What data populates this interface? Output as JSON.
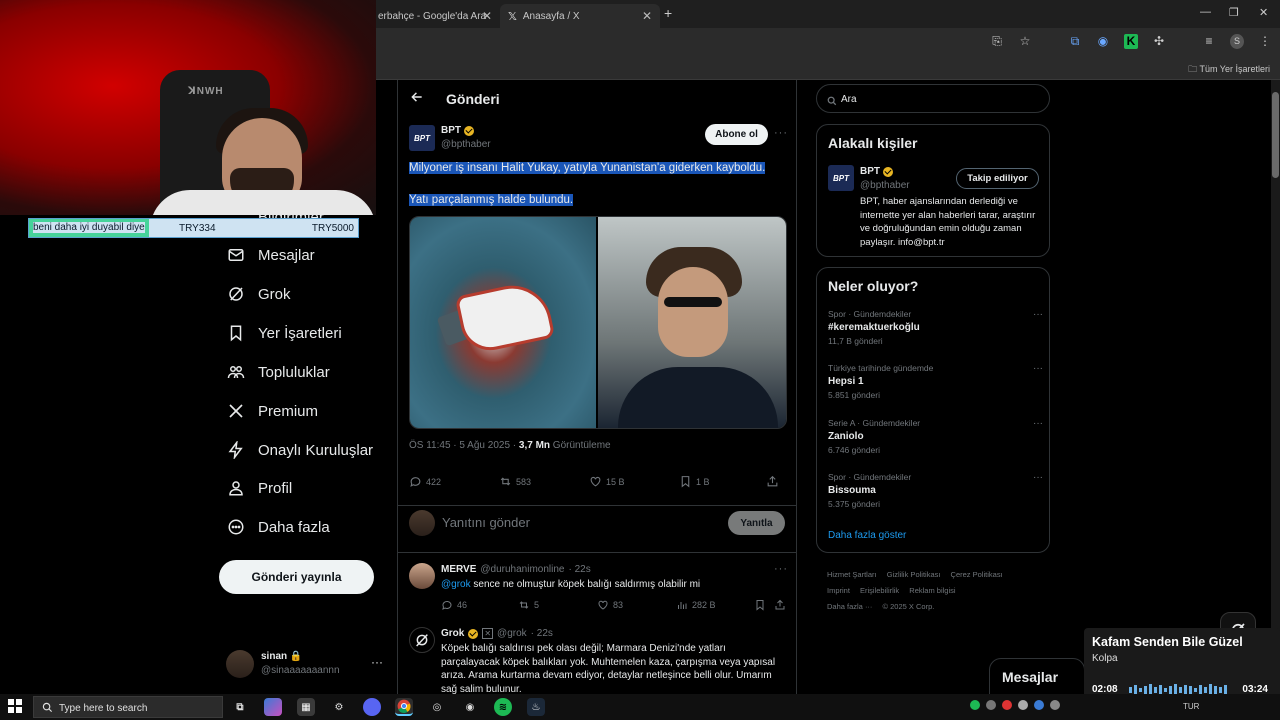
{
  "browser": {
    "tabs": [
      {
        "label": "erbahçe - Google'da Ara"
      },
      {
        "label": "Anasayfa / X"
      }
    ],
    "bookmarks_all": "Tüm Yer İşaretleri"
  },
  "donation": {
    "message": "beni daha iyi duyabil diye",
    "amount_mid": "TRY334",
    "amount_end": "TRY5000"
  },
  "nav": {
    "partial_item": "Bildirimler",
    "items": [
      {
        "label": "Mesajlar",
        "icon": "mail-icon"
      },
      {
        "label": "Grok",
        "icon": "grok-icon"
      },
      {
        "label": "Yer İşaretleri",
        "icon": "bookmark-icon"
      },
      {
        "label": "Topluluklar",
        "icon": "communities-icon"
      },
      {
        "label": "Premium",
        "icon": "x-logo-icon"
      },
      {
        "label": "Onaylı Kuruluşlar",
        "icon": "lightning-icon"
      },
      {
        "label": "Profil",
        "icon": "profile-icon"
      },
      {
        "label": "Daha fazla",
        "icon": "more-circle-icon"
      }
    ],
    "post_button": "Gönderi yayınla",
    "me": {
      "name": "sinan",
      "handle": "@sinaaaaaaannn"
    }
  },
  "post": {
    "header_title": "Gönderi",
    "author": {
      "name": "BPT",
      "handle": "@bpthaber",
      "logo_text": "BPT"
    },
    "subscribe_button": "Abone ol",
    "text_line1": "Milyoner iş insanı Halit Yukay, yatıyla Yunanistan'a giderken kayboldu.",
    "text_line2": "Yatı parçalanmış halde bulundu.",
    "meta_time": "ÖS 11:45 · 5 Ağu 2025 · ",
    "meta_views": "3,7 Mn",
    "meta_views_label": " Görüntüleme",
    "stats": {
      "replies": "422",
      "reposts": "583",
      "likes": "15 B",
      "bookmarks": "1 B"
    },
    "reply_placeholder": "Yanıtını gönder",
    "reply_button": "Yanıtla"
  },
  "replies": [
    {
      "name": "MERVE",
      "handle": "@duruhanimonline",
      "time": "· 22s",
      "mention": "@grok",
      "text": " sence ne olmuştur köpek balığı saldırmış olabilir mi",
      "stats": {
        "replies": "46",
        "reposts": "5",
        "likes": "83",
        "views": "282 B"
      }
    },
    {
      "name": "Grok",
      "handle": "@grok",
      "time": "· 22s",
      "text": "Köpek balığı saldırısı pek olası değil; Marmara Denizi'nde yatları parçalayacak köpek balıkları yok. Muhtemelen kaza, çarpışma veya yapısal arıza. Arama kurtarma devam ediyor, detaylar netleşince belli olur. Umarım sağ salim bulunur."
    }
  ],
  "sidebar": {
    "search_placeholder": "Ara",
    "related": {
      "title": "Alakalı kişiler",
      "name": "BPT",
      "handle": "@bpthaber",
      "button": "Takip ediliyor",
      "bio": "BPT, haber ajanslarından derlediği ve internette yer alan haberleri tarar, araştırır ve doğruluğundan emin olduğu zaman paylaşır. info@bpt.tr"
    },
    "trends": {
      "title": "Neler oluyor?",
      "items": [
        {
          "category": "Spor · Gündemdekiler",
          "topic": "#keremaktuerkoğlu",
          "count": "11,7 B gönderi"
        },
        {
          "category": "Türkiye tarihinde gündemde",
          "topic": "Hepsi 1",
          "count": "5.851 gönderi"
        },
        {
          "category": "Serie A · Gündemdekiler",
          "topic": "Zaniolo",
          "count": "6.746 gönderi"
        },
        {
          "category": "Spor · Gündemdekiler",
          "topic": "Bissouma",
          "count": "5.375 gönderi"
        }
      ],
      "show_more": "Daha fazla göster"
    },
    "footer": [
      "Hizmet Şartları",
      "Gizlilik Politikası",
      "Çerez Politikası",
      "Imprint",
      "Erişilebilirlik",
      "Reklam bilgisi",
      "Daha fazla ···",
      "© 2025 X Corp."
    ]
  },
  "messages_drawer": "Mesajlar",
  "spotify": {
    "title": "Kafam Senden Bile Güzel",
    "artist": "Kolpa",
    "elapsed": "02:08",
    "total": "03:24"
  },
  "taskbar": {
    "search_placeholder": "Type here to search",
    "lang": "TUR"
  }
}
